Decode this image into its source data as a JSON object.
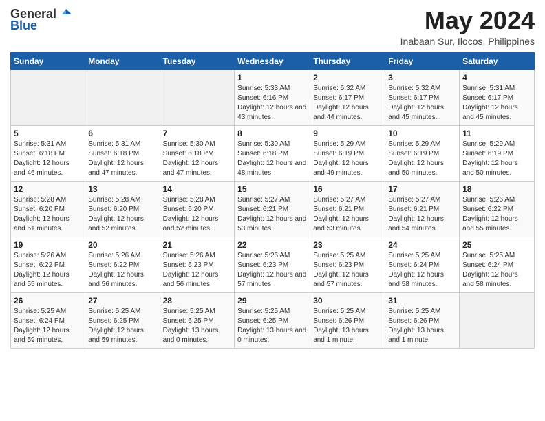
{
  "logo": {
    "general": "General",
    "blue": "Blue"
  },
  "header": {
    "title": "May 2024",
    "subtitle": "Inabaan Sur, Ilocos, Philippines"
  },
  "weekdays": [
    "Sunday",
    "Monday",
    "Tuesday",
    "Wednesday",
    "Thursday",
    "Friday",
    "Saturday"
  ],
  "weeks": [
    [
      {
        "day": "",
        "info": ""
      },
      {
        "day": "",
        "info": ""
      },
      {
        "day": "",
        "info": ""
      },
      {
        "day": "1",
        "sunrise": "Sunrise: 5:33 AM",
        "sunset": "Sunset: 6:16 PM",
        "daylight": "Daylight: 12 hours and 43 minutes."
      },
      {
        "day": "2",
        "sunrise": "Sunrise: 5:32 AM",
        "sunset": "Sunset: 6:17 PM",
        "daylight": "Daylight: 12 hours and 44 minutes."
      },
      {
        "day": "3",
        "sunrise": "Sunrise: 5:32 AM",
        "sunset": "Sunset: 6:17 PM",
        "daylight": "Daylight: 12 hours and 45 minutes."
      },
      {
        "day": "4",
        "sunrise": "Sunrise: 5:31 AM",
        "sunset": "Sunset: 6:17 PM",
        "daylight": "Daylight: 12 hours and 45 minutes."
      }
    ],
    [
      {
        "day": "5",
        "sunrise": "Sunrise: 5:31 AM",
        "sunset": "Sunset: 6:18 PM",
        "daylight": "Daylight: 12 hours and 46 minutes."
      },
      {
        "day": "6",
        "sunrise": "Sunrise: 5:31 AM",
        "sunset": "Sunset: 6:18 PM",
        "daylight": "Daylight: 12 hours and 47 minutes."
      },
      {
        "day": "7",
        "sunrise": "Sunrise: 5:30 AM",
        "sunset": "Sunset: 6:18 PM",
        "daylight": "Daylight: 12 hours and 47 minutes."
      },
      {
        "day": "8",
        "sunrise": "Sunrise: 5:30 AM",
        "sunset": "Sunset: 6:18 PM",
        "daylight": "Daylight: 12 hours and 48 minutes."
      },
      {
        "day": "9",
        "sunrise": "Sunrise: 5:29 AM",
        "sunset": "Sunset: 6:19 PM",
        "daylight": "Daylight: 12 hours and 49 minutes."
      },
      {
        "day": "10",
        "sunrise": "Sunrise: 5:29 AM",
        "sunset": "Sunset: 6:19 PM",
        "daylight": "Daylight: 12 hours and 50 minutes."
      },
      {
        "day": "11",
        "sunrise": "Sunrise: 5:29 AM",
        "sunset": "Sunset: 6:19 PM",
        "daylight": "Daylight: 12 hours and 50 minutes."
      }
    ],
    [
      {
        "day": "12",
        "sunrise": "Sunrise: 5:28 AM",
        "sunset": "Sunset: 6:20 PM",
        "daylight": "Daylight: 12 hours and 51 minutes."
      },
      {
        "day": "13",
        "sunrise": "Sunrise: 5:28 AM",
        "sunset": "Sunset: 6:20 PM",
        "daylight": "Daylight: 12 hours and 52 minutes."
      },
      {
        "day": "14",
        "sunrise": "Sunrise: 5:28 AM",
        "sunset": "Sunset: 6:20 PM",
        "daylight": "Daylight: 12 hours and 52 minutes."
      },
      {
        "day": "15",
        "sunrise": "Sunrise: 5:27 AM",
        "sunset": "Sunset: 6:21 PM",
        "daylight": "Daylight: 12 hours and 53 minutes."
      },
      {
        "day": "16",
        "sunrise": "Sunrise: 5:27 AM",
        "sunset": "Sunset: 6:21 PM",
        "daylight": "Daylight: 12 hours and 53 minutes."
      },
      {
        "day": "17",
        "sunrise": "Sunrise: 5:27 AM",
        "sunset": "Sunset: 6:21 PM",
        "daylight": "Daylight: 12 hours and 54 minutes."
      },
      {
        "day": "18",
        "sunrise": "Sunrise: 5:26 AM",
        "sunset": "Sunset: 6:22 PM",
        "daylight": "Daylight: 12 hours and 55 minutes."
      }
    ],
    [
      {
        "day": "19",
        "sunrise": "Sunrise: 5:26 AM",
        "sunset": "Sunset: 6:22 PM",
        "daylight": "Daylight: 12 hours and 55 minutes."
      },
      {
        "day": "20",
        "sunrise": "Sunrise: 5:26 AM",
        "sunset": "Sunset: 6:22 PM",
        "daylight": "Daylight: 12 hours and 56 minutes."
      },
      {
        "day": "21",
        "sunrise": "Sunrise: 5:26 AM",
        "sunset": "Sunset: 6:23 PM",
        "daylight": "Daylight: 12 hours and 56 minutes."
      },
      {
        "day": "22",
        "sunrise": "Sunrise: 5:26 AM",
        "sunset": "Sunset: 6:23 PM",
        "daylight": "Daylight: 12 hours and 57 minutes."
      },
      {
        "day": "23",
        "sunrise": "Sunrise: 5:25 AM",
        "sunset": "Sunset: 6:23 PM",
        "daylight": "Daylight: 12 hours and 57 minutes."
      },
      {
        "day": "24",
        "sunrise": "Sunrise: 5:25 AM",
        "sunset": "Sunset: 6:24 PM",
        "daylight": "Daylight: 12 hours and 58 minutes."
      },
      {
        "day": "25",
        "sunrise": "Sunrise: 5:25 AM",
        "sunset": "Sunset: 6:24 PM",
        "daylight": "Daylight: 12 hours and 58 minutes."
      }
    ],
    [
      {
        "day": "26",
        "sunrise": "Sunrise: 5:25 AM",
        "sunset": "Sunset: 6:24 PM",
        "daylight": "Daylight: 12 hours and 59 minutes."
      },
      {
        "day": "27",
        "sunrise": "Sunrise: 5:25 AM",
        "sunset": "Sunset: 6:25 PM",
        "daylight": "Daylight: 12 hours and 59 minutes."
      },
      {
        "day": "28",
        "sunrise": "Sunrise: 5:25 AM",
        "sunset": "Sunset: 6:25 PM",
        "daylight": "Daylight: 13 hours and 0 minutes."
      },
      {
        "day": "29",
        "sunrise": "Sunrise: 5:25 AM",
        "sunset": "Sunset: 6:25 PM",
        "daylight": "Daylight: 13 hours and 0 minutes."
      },
      {
        "day": "30",
        "sunrise": "Sunrise: 5:25 AM",
        "sunset": "Sunset: 6:26 PM",
        "daylight": "Daylight: 13 hours and 1 minute."
      },
      {
        "day": "31",
        "sunrise": "Sunrise: 5:25 AM",
        "sunset": "Sunset: 6:26 PM",
        "daylight": "Daylight: 13 hours and 1 minute."
      },
      {
        "day": "",
        "info": ""
      }
    ]
  ]
}
